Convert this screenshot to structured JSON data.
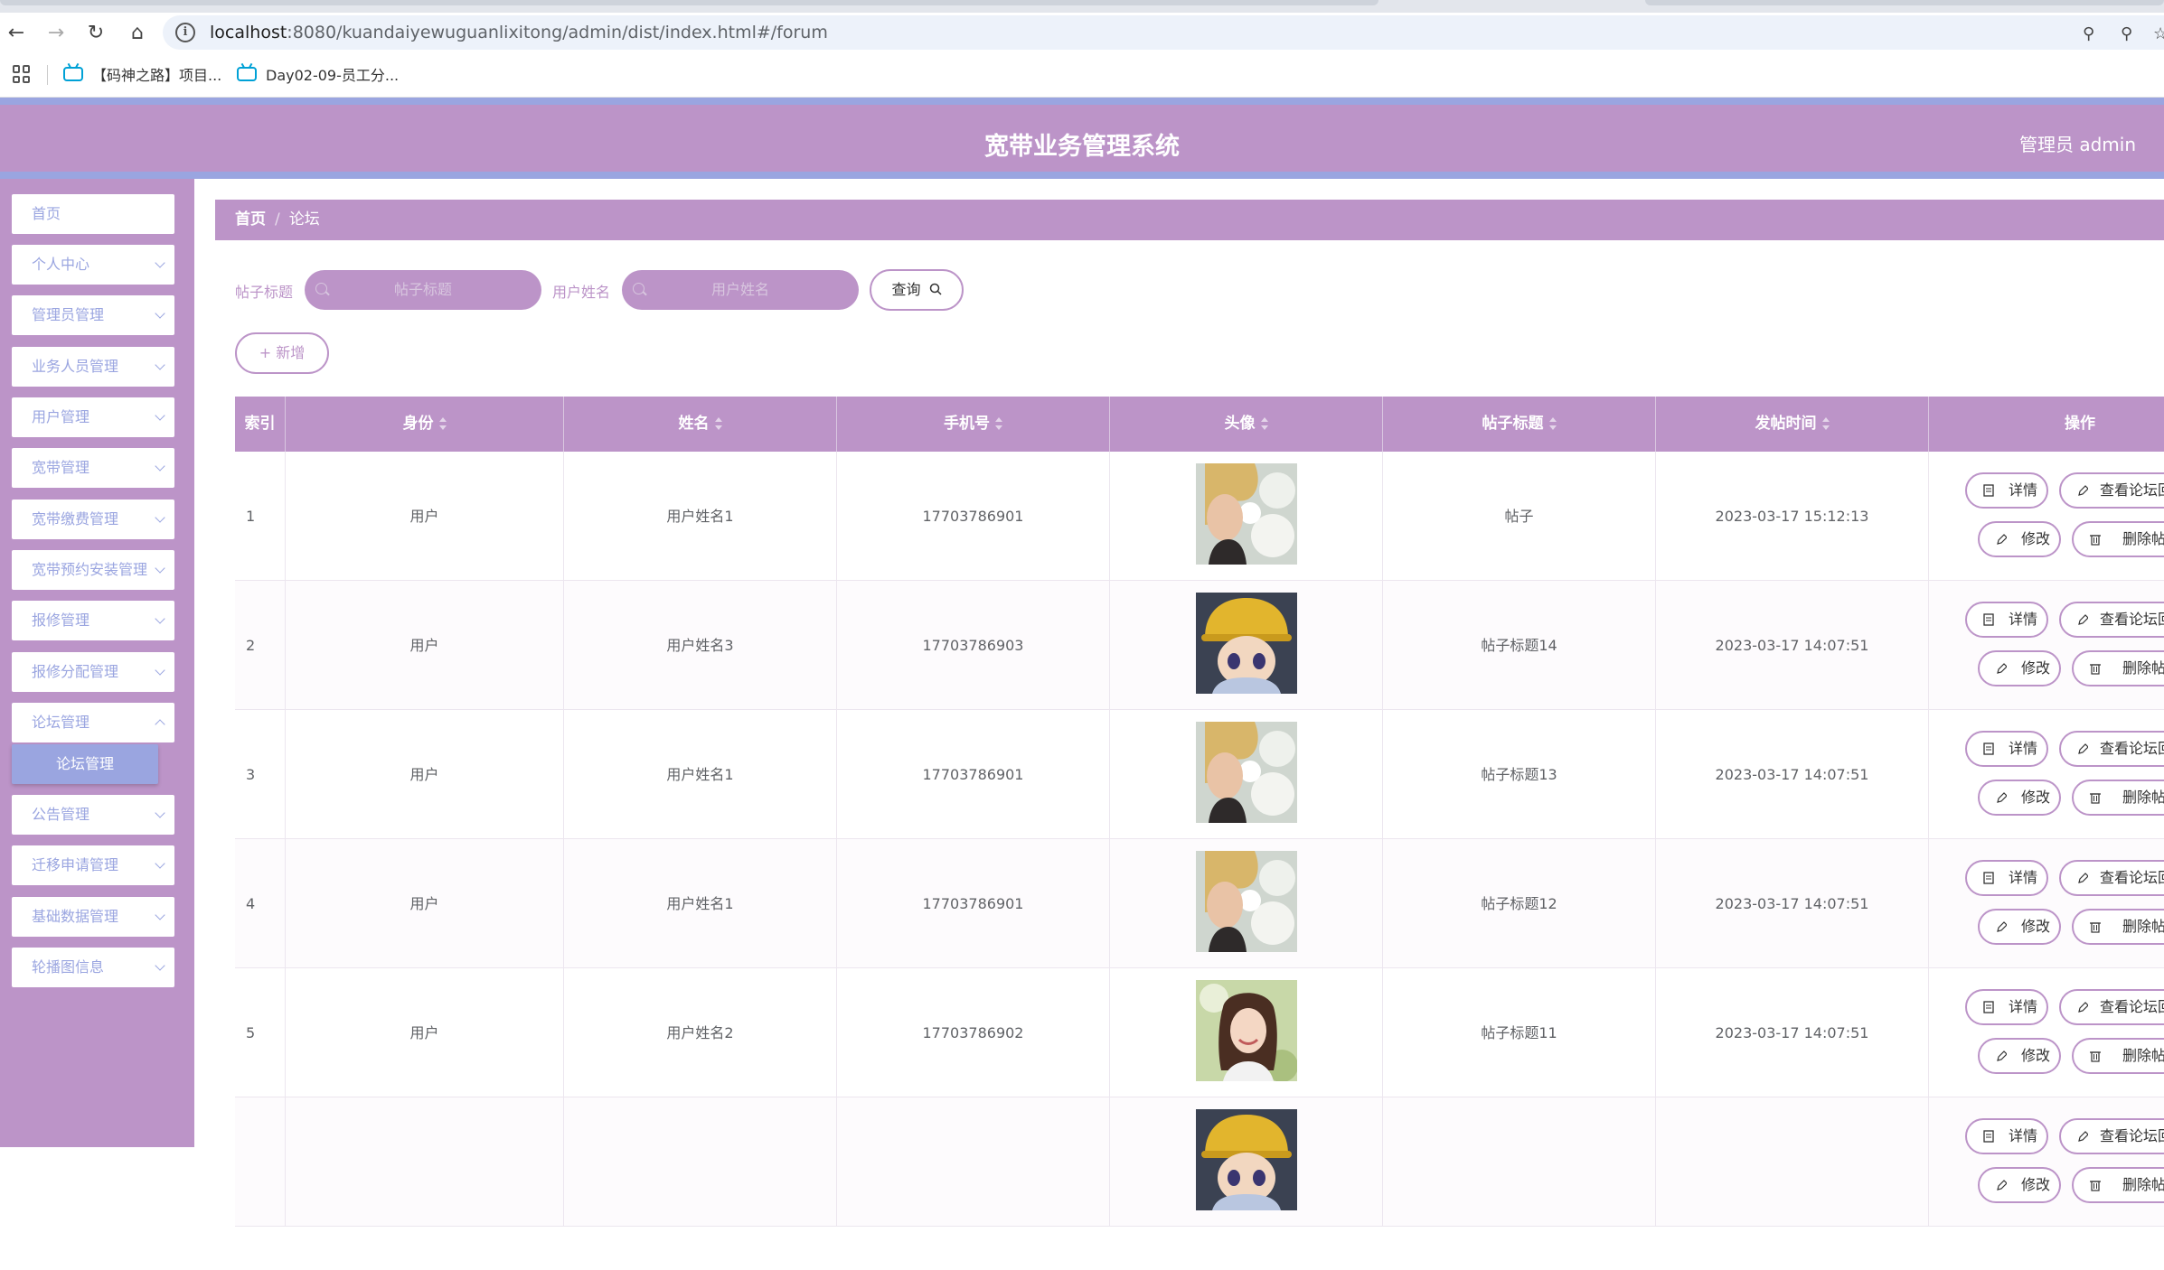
{
  "browser": {
    "url_host": "localhost",
    "url_rest": ":8080/kuandaiyewuguanlixitong/admin/dist/index.html#/forum",
    "bookmarks": [
      "【码神之路】项目...",
      "Day02-09-员工分..."
    ]
  },
  "header": {
    "title": "宽带业务管理系统",
    "user": "管理员 admin"
  },
  "sidebar": {
    "items": [
      {
        "label": "首页"
      },
      {
        "label": "个人中心"
      },
      {
        "label": "管理员管理"
      },
      {
        "label": "业务人员管理"
      },
      {
        "label": "用户管理"
      },
      {
        "label": "宽带管理"
      },
      {
        "label": "宽带缴费管理"
      },
      {
        "label": "宽带预约安装管理"
      },
      {
        "label": "报修管理"
      },
      {
        "label": "报修分配管理"
      },
      {
        "label": "论坛管理"
      },
      {
        "label": "公告管理"
      },
      {
        "label": "迁移申请管理"
      },
      {
        "label": "基础数据管理"
      },
      {
        "label": "轮播图信息"
      }
    ],
    "active_sub": "论坛管理"
  },
  "breadcrumb": {
    "home": "首页",
    "sep": "/",
    "current": "论坛"
  },
  "search": {
    "title_label": "帖子标题",
    "title_placeholder": "帖子标题",
    "name_label": "用户姓名",
    "name_placeholder": "用户姓名",
    "query_button": "查询",
    "add_button": "新增"
  },
  "table": {
    "columns": [
      "索引",
      "身份",
      "姓名",
      "手机号",
      "头像",
      "帖子标题",
      "发帖时间",
      "操作"
    ],
    "rows": [
      {
        "index": "1",
        "identity": "用户",
        "name": "用户姓名1",
        "phone": "17703786901",
        "avatar": "photo-boy-flowers",
        "title": "帖子",
        "time": "2023-03-17 15:12:13"
      },
      {
        "index": "2",
        "identity": "用户",
        "name": "用户姓名3",
        "phone": "17703786903",
        "avatar": "anime-boy-yellow-hat",
        "title": "帖子标题14",
        "time": "2023-03-17 14:07:51"
      },
      {
        "index": "3",
        "identity": "用户",
        "name": "用户姓名1",
        "phone": "17703786901",
        "avatar": "photo-boy-flowers",
        "title": "帖子标题13",
        "time": "2023-03-17 14:07:51"
      },
      {
        "index": "4",
        "identity": "用户",
        "name": "用户姓名1",
        "phone": "17703786901",
        "avatar": "photo-boy-flowers",
        "title": "帖子标题12",
        "time": "2023-03-17 14:07:51"
      },
      {
        "index": "5",
        "identity": "用户",
        "name": "用户姓名2",
        "phone": "17703786902",
        "avatar": "photo-girl-smiling",
        "title": "帖子标题11",
        "time": "2023-03-17 14:07:51"
      },
      {
        "index": "",
        "identity": "",
        "name": "",
        "phone": "",
        "avatar": "anime-boy-yellow-hat",
        "title": "",
        "time": ""
      }
    ],
    "actions": {
      "detail": "详情",
      "view_replies": "查看论坛回复",
      "edit": "修改",
      "delete": "删除帖子"
    }
  },
  "colors": {
    "primary": "#bc94c8",
    "accent": "#9aa5e0"
  }
}
